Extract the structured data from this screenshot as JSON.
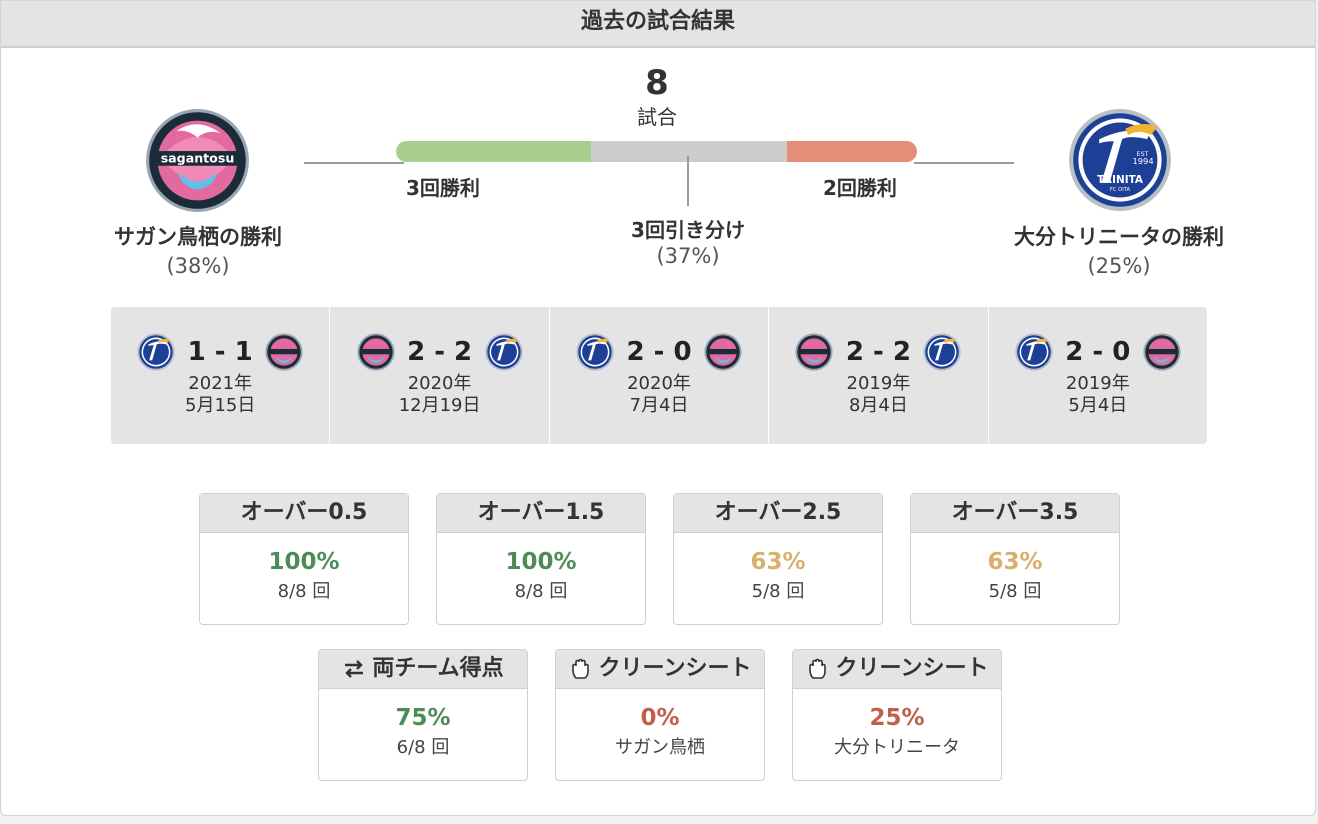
{
  "header": {
    "title": "過去の試合結果"
  },
  "summary": {
    "total": "8",
    "total_label": "試合",
    "home_wins_label": "3回勝利",
    "away_wins_label": "2回勝利",
    "draws_label": "3回引き分け",
    "draws_pct": "(37%)",
    "home_team_label": "サガン鳥栖の勝利",
    "home_pct": "(38%)",
    "away_team_label": "大分トリニータの勝利",
    "away_pct": "(25%)",
    "bar": {
      "home_fraction": 0.375,
      "draw_fraction": 0.375,
      "away_fraction": 0.25
    },
    "colors": {
      "home": "#a8cf8e",
      "draw": "#cccccc",
      "away": "#e58e76"
    }
  },
  "teams": {
    "home": {
      "logo_text": "sagantosu",
      "icon": "sagan-tosu-logo"
    },
    "away": {
      "logo_text_est": "EST",
      "logo_year": "1994",
      "logo_name": "TRINITA",
      "logo_sub": "FC OITA",
      "icon": "oita-trinita-logo"
    }
  },
  "matches": [
    {
      "score": "1 - 1",
      "year": "2021年",
      "date": "5月15日",
      "left": "away",
      "right": "home"
    },
    {
      "score": "2 - 2",
      "year": "2020年",
      "date": "12月19日",
      "left": "home",
      "right": "away"
    },
    {
      "score": "2 - 0",
      "year": "2020年",
      "date": "7月4日",
      "left": "away",
      "right": "home"
    },
    {
      "score": "2 - 2",
      "year": "2019年",
      "date": "8月4日",
      "left": "home",
      "right": "away"
    },
    {
      "score": "2 - 0",
      "year": "2019年",
      "date": "5月4日",
      "left": "away",
      "right": "home"
    }
  ],
  "stats": [
    {
      "title": "オーバー0.5",
      "value": "100%",
      "sub": "8/8 回",
      "tone": "green"
    },
    {
      "title": "オーバー1.5",
      "value": "100%",
      "sub": "8/8 回",
      "tone": "green"
    },
    {
      "title": "オーバー2.5",
      "value": "63%",
      "sub": "5/8 回",
      "tone": "gold"
    },
    {
      "title": "オーバー3.5",
      "value": "63%",
      "sub": "5/8 回",
      "tone": "gold"
    },
    {
      "title": "両チーム得点",
      "value": "75%",
      "sub": "6/8 回",
      "tone": "green",
      "icon": "swap-arrows-icon"
    },
    {
      "title": "クリーンシート",
      "value": "0%",
      "sub": "サガン鳥栖",
      "tone": "red",
      "icon": "glove-icon"
    },
    {
      "title": "クリーンシート",
      "value": "25%",
      "sub": "大分トリニータ",
      "tone": "red",
      "icon": "glove-icon"
    }
  ]
}
